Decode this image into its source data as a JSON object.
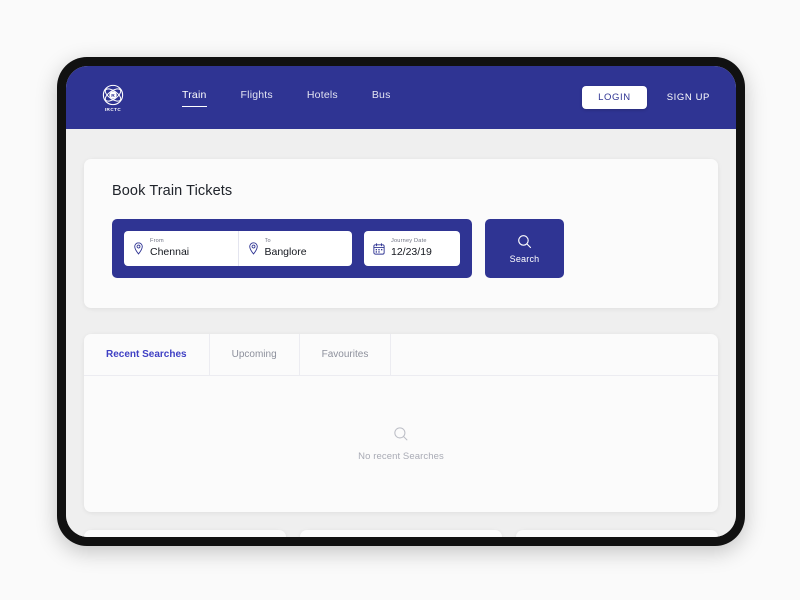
{
  "brand": {
    "name": "IRCTC",
    "logo_icon": "irctc-logo-icon"
  },
  "navbar": {
    "links": [
      {
        "label": "Train",
        "active": true
      },
      {
        "label": "Flights",
        "active": false
      },
      {
        "label": "Hotels",
        "active": false
      },
      {
        "label": "Bus",
        "active": false
      }
    ],
    "login_label": "LOGIN",
    "signup_label": "SIGN UP",
    "background_color": "#2f3493"
  },
  "booking": {
    "title": "Book Train Tickets",
    "fields": [
      {
        "label": "From",
        "value": "Chennai",
        "placeholder": "From",
        "icon": "location-pin-icon"
      },
      {
        "label": "To",
        "value": "Banglore",
        "placeholder": "To",
        "icon": "location-pin-icon"
      },
      {
        "label": "Journey Date",
        "value": "12/23/19",
        "placeholder": "Journey Date",
        "icon": "calendar-icon"
      }
    ],
    "search_label": "Search",
    "search_icon": "search-icon"
  },
  "tabs": [
    {
      "label": "Recent Searches",
      "active": true
    },
    {
      "label": "Upcoming",
      "active": false
    },
    {
      "label": "Favourites",
      "active": false
    }
  ],
  "empty_state": {
    "icon": "search-icon",
    "text": "No recent Searches"
  },
  "bottom_cards": [
    {
      "id": "teaser-card-1"
    },
    {
      "id": "teaser-card-2"
    },
    {
      "id": "teaser-card-3"
    }
  ],
  "colors": {
    "brand_blue": "#2f3493",
    "tab_active": "#3f40c4",
    "page_background": "#efefef",
    "card_background": "#fbfbfb",
    "device_frame": "#111111"
  }
}
